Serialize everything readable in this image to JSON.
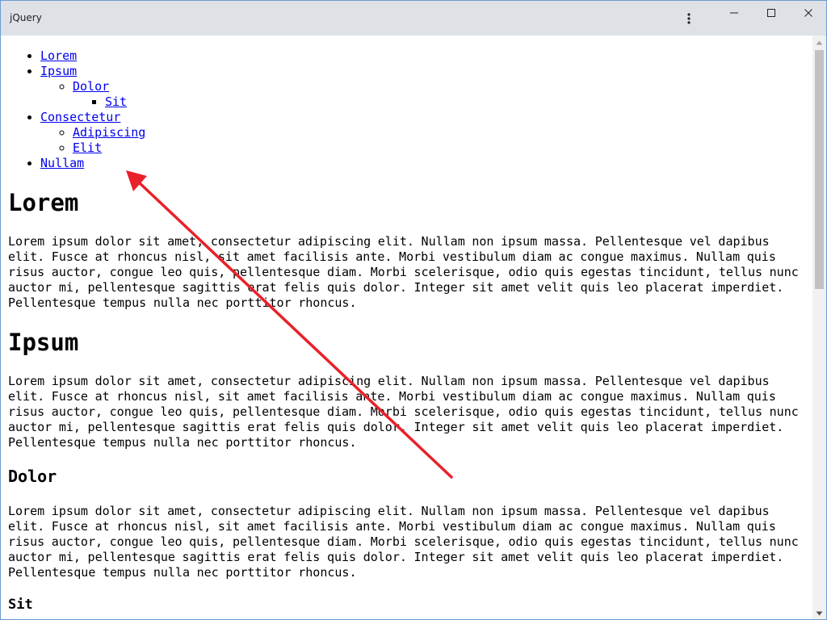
{
  "window": {
    "title": "jQuery"
  },
  "toc": {
    "lorem": "Lorem",
    "ipsum": "Ipsum",
    "dolor": "Dolor",
    "sit": "Sit",
    "consectetur": "Consectetur",
    "adipiscing": "Adipiscing",
    "elit": "Elit",
    "nullam": "Nullam"
  },
  "sections": {
    "lorem": {
      "heading": "Lorem",
      "text": "Lorem ipsum dolor sit amet, consectetur adipiscing elit. Nullam non ipsum massa. Pellentesque vel dapibus elit. Fusce at rhoncus nisl, sit amet facilisis ante. Morbi vestibulum diam ac congue maximus. Nullam quis risus auctor, congue leo quis, pellentesque diam. Morbi scelerisque, odio quis egestas tincidunt, tellus nunc auctor mi, pellentesque sagittis erat felis quis dolor. Integer sit amet velit quis leo placerat imperdiet. Pellentesque tempus nulla nec porttitor rhoncus."
    },
    "ipsum": {
      "heading": "Ipsum",
      "text": "Lorem ipsum dolor sit amet, consectetur adipiscing elit. Nullam non ipsum massa. Pellentesque vel dapibus elit. Fusce at rhoncus nisl, sit amet facilisis ante. Morbi vestibulum diam ac congue maximus. Nullam quis risus auctor, congue leo quis, pellentesque diam. Morbi scelerisque, odio quis egestas tincidunt, tellus nunc auctor mi, pellentesque sagittis erat felis quis dolor. Integer sit amet velit quis leo placerat imperdiet. Pellentesque tempus nulla nec porttitor rhoncus."
    },
    "dolor": {
      "heading": "Dolor",
      "text": "Lorem ipsum dolor sit amet, consectetur adipiscing elit. Nullam non ipsum massa. Pellentesque vel dapibus elit. Fusce at rhoncus nisl, sit amet facilisis ante. Morbi vestibulum diam ac congue maximus. Nullam quis risus auctor, congue leo quis, pellentesque diam. Morbi scelerisque, odio quis egestas tincidunt, tellus nunc auctor mi, pellentesque sagittis erat felis quis dolor. Integer sit amet velit quis leo placerat imperdiet. Pellentesque tempus nulla nec porttitor rhoncus."
    },
    "sit": {
      "heading": "Sit"
    }
  },
  "colors": {
    "titlebar": "#dee1e6",
    "link": "#0000ee",
    "annotation_arrow": "#e8212a",
    "scroll_thumb": "#c1c1c1"
  },
  "icons": {
    "menu": "kebab-menu-icon",
    "minimize": "minimize-icon",
    "maximize": "maximize-icon",
    "close": "close-icon"
  }
}
